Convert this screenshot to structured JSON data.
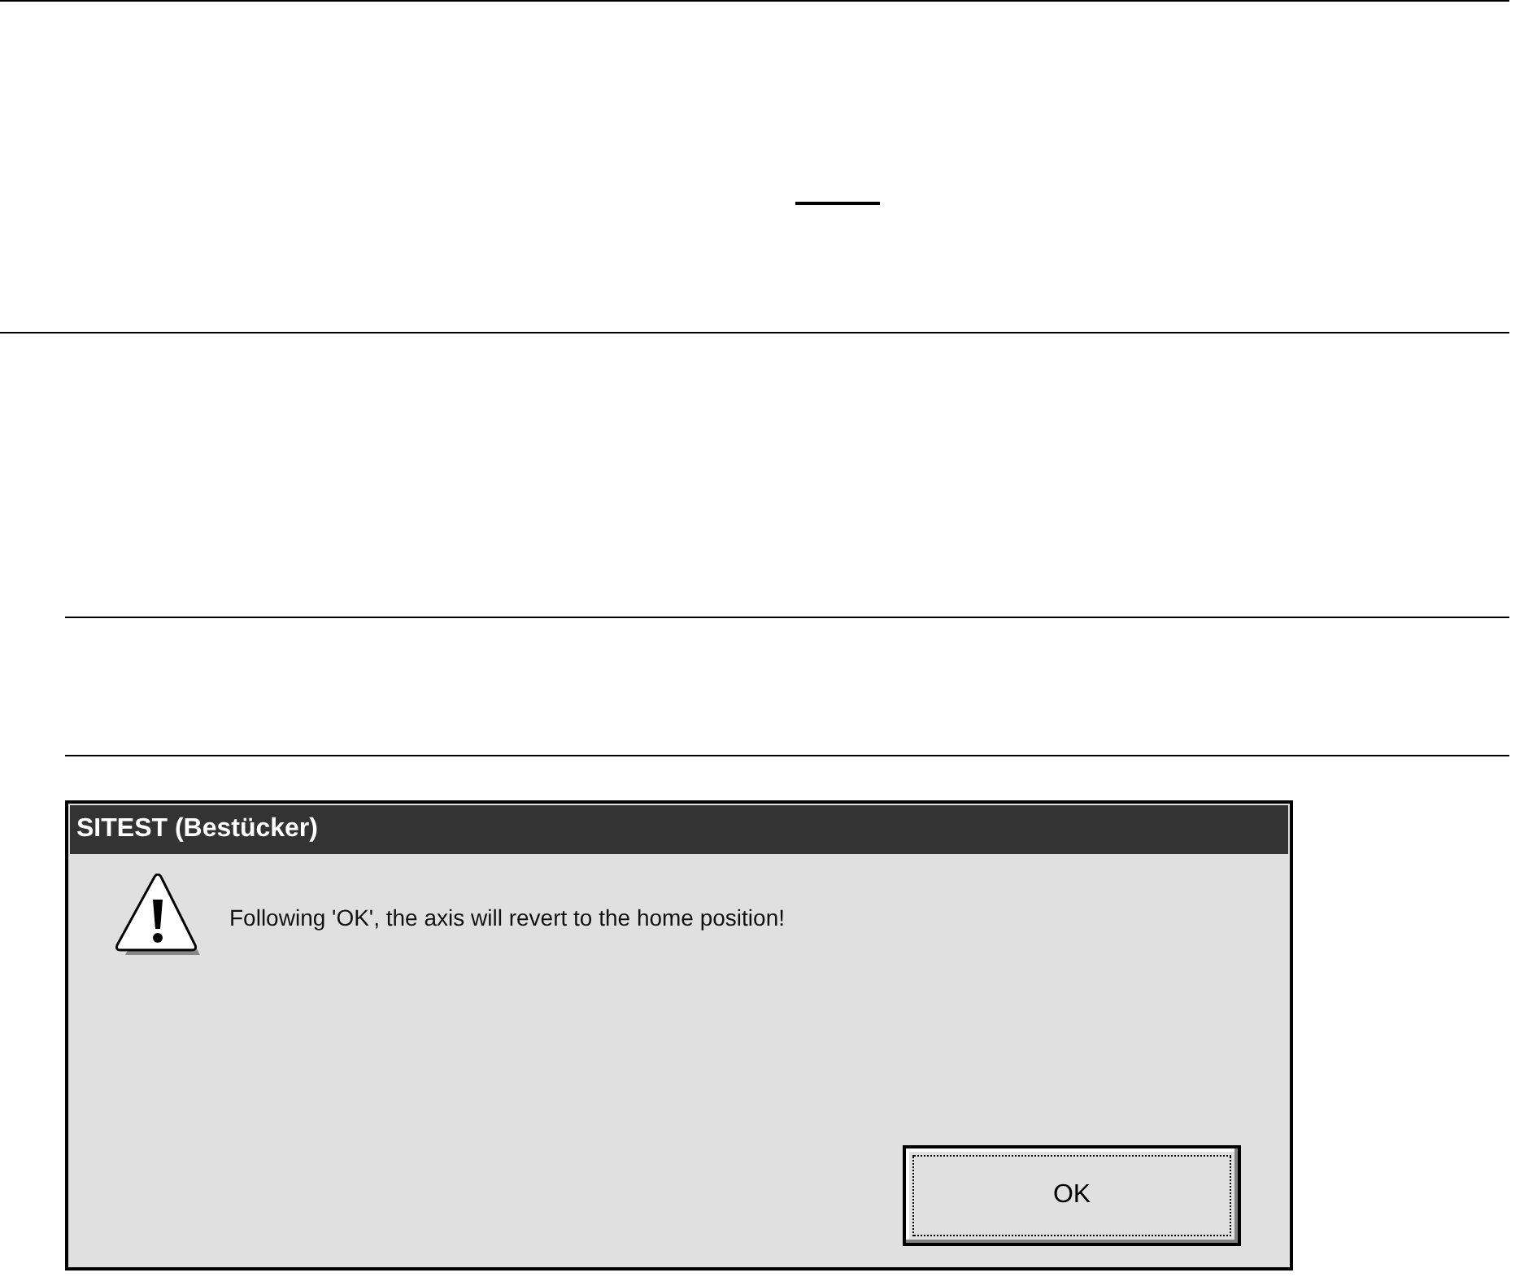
{
  "dialog": {
    "title": "SITEST (Bestücker)",
    "message": "Following 'OK', the axis will revert to the home position!",
    "buttons": [
      {
        "label": "OK",
        "focused": true
      }
    ]
  }
}
